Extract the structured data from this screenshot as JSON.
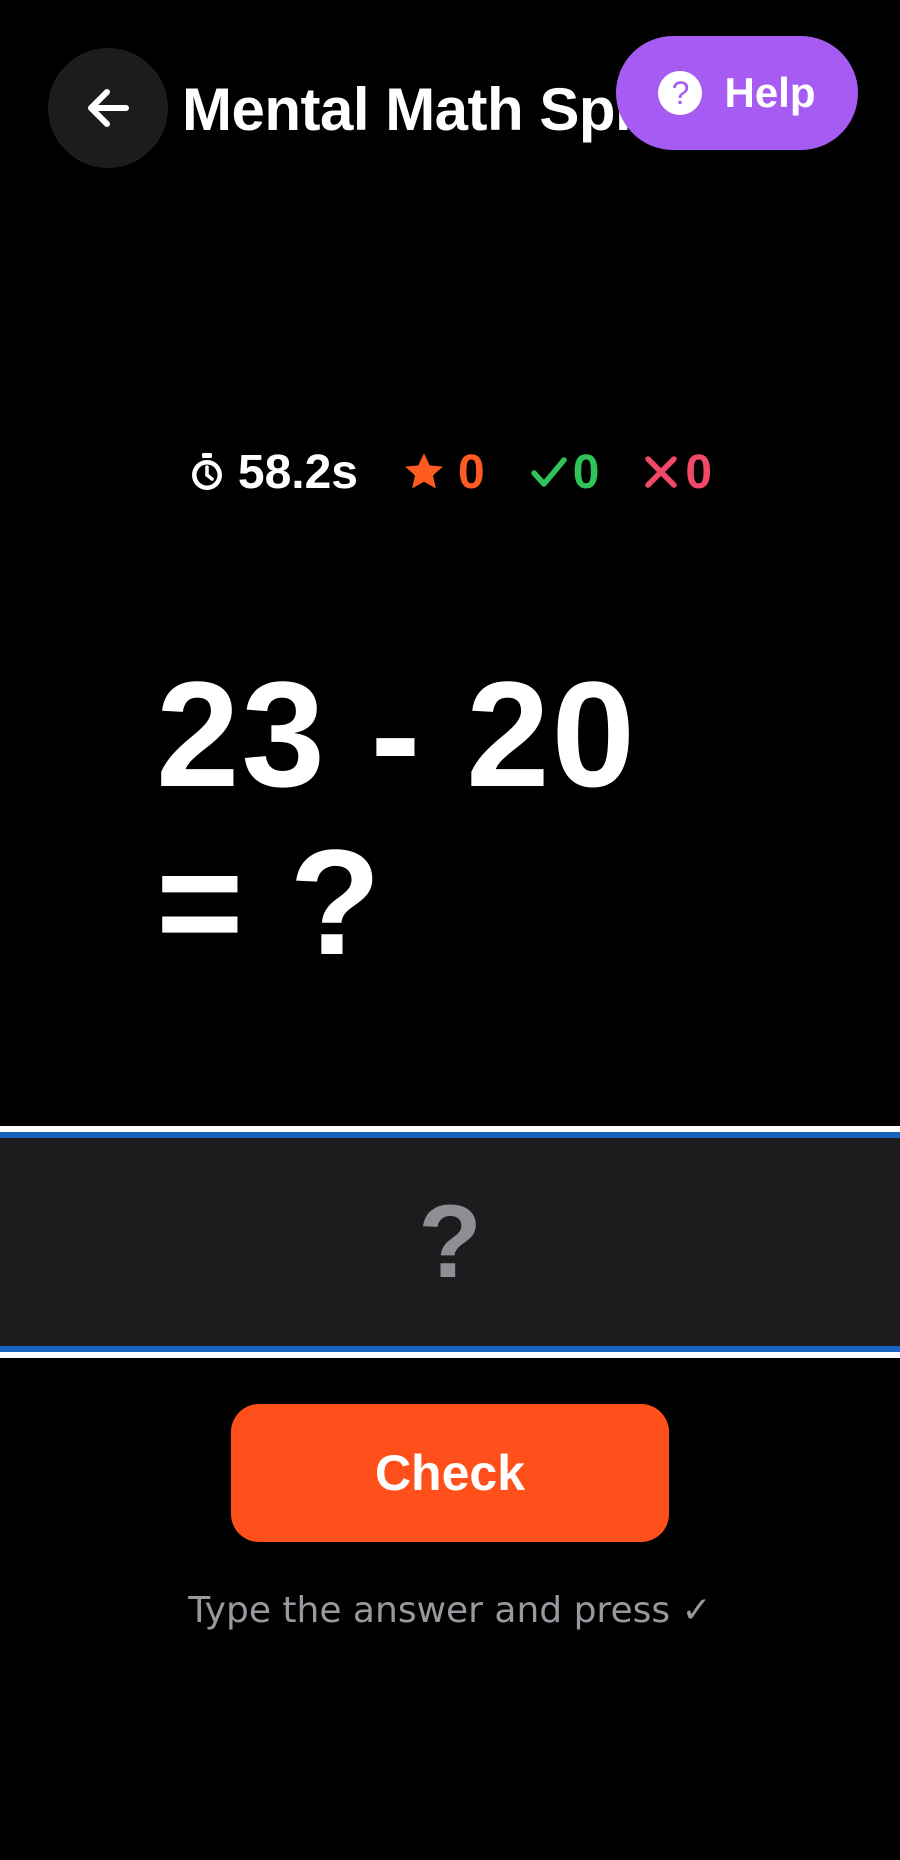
{
  "header": {
    "title": "Mental Math Sprint",
    "back_icon": "arrow-left-icon",
    "help": {
      "label": "Help",
      "icon": "question-circle-icon",
      "icon_glyph": "?"
    }
  },
  "stats": {
    "timer": {
      "icon": "stopwatch-icon",
      "value": "58.2s"
    },
    "score": {
      "icon": "star-icon",
      "value": "0"
    },
    "correct": {
      "icon": "checkmark-icon",
      "value": "0"
    },
    "wrong": {
      "icon": "cross-icon",
      "value": "0"
    }
  },
  "problem": {
    "line1": "23 - 20",
    "line2": "= ?"
  },
  "answer": {
    "value": "",
    "placeholder": "?"
  },
  "check_button": {
    "label": "Check"
  },
  "hint": "Type the answer and press ✓",
  "colors": {
    "background": "#000000",
    "help_purple": "#a65cf2",
    "check_orange": "#ff4f1a",
    "score_orange": "#ff5a1f",
    "correct_green": "#2ec45a",
    "wrong_red": "#f04866",
    "field_border_blue": "#1565c0"
  }
}
